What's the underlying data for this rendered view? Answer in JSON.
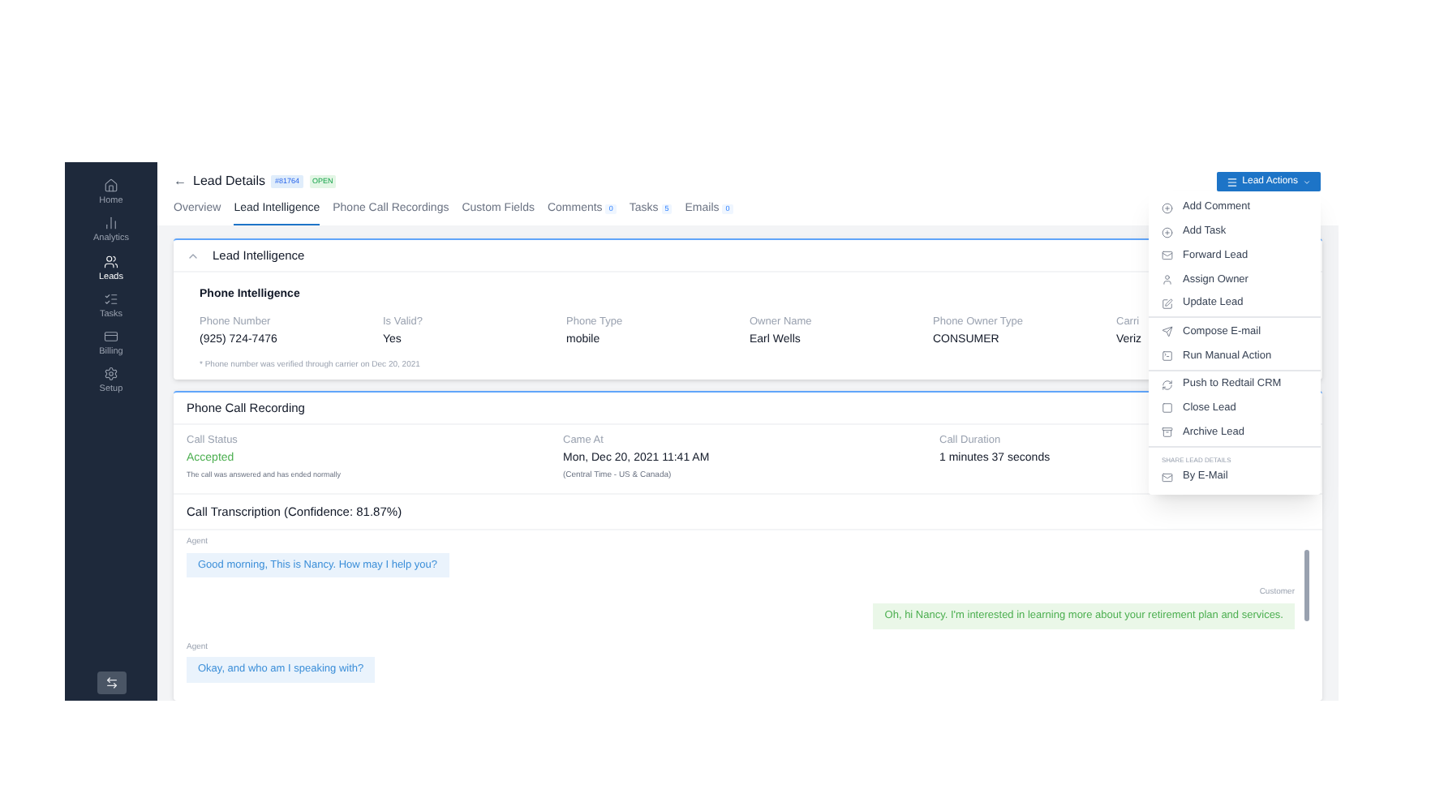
{
  "sidebar": {
    "items": [
      {
        "label": "Home",
        "selected": false
      },
      {
        "label": "Analytics",
        "selected": false
      },
      {
        "label": "Leads",
        "selected": true
      },
      {
        "label": "Tasks",
        "selected": false
      },
      {
        "label": "Billing",
        "selected": false
      },
      {
        "label": "Setup",
        "selected": false
      }
    ]
  },
  "header": {
    "back": "←",
    "title": "Lead Details",
    "badges": [
      {
        "text": "#81764",
        "kind": "id"
      },
      {
        "text": "OPEN",
        "kind": "status"
      }
    ],
    "actions_button": "Lead Actions"
  },
  "tabs": [
    {
      "label": "Overview",
      "selected": false
    },
    {
      "label": "Lead Intelligence",
      "selected": true
    },
    {
      "label": "Phone Call Recordings",
      "selected": false
    },
    {
      "label": "Custom Fields",
      "selected": false
    },
    {
      "label": "Comments",
      "count": "0",
      "selected": false
    },
    {
      "label": "Tasks",
      "count": "5",
      "selected": false
    },
    {
      "label": "Emails",
      "count": "0",
      "selected": false
    }
  ],
  "lead_intelligence": {
    "title": "Lead Intelligence",
    "expanded": true,
    "section": "Phone Intelligence",
    "fields": [
      {
        "label": "Phone Number",
        "value": "(925) 724-7476"
      },
      {
        "label": "Is Valid?",
        "value": "Yes"
      },
      {
        "label": "Phone Type",
        "value": "mobile"
      },
      {
        "label": "Owner Name",
        "value": "Earl Wells"
      },
      {
        "label": "Phone Owner Type",
        "value": "CONSUMER"
      },
      {
        "label": "Carri",
        "value": "Veriz"
      }
    ],
    "note": "* Phone number was verified through carrier on Dec 20, 2021"
  },
  "call_recording": {
    "title": "Phone Call Recording",
    "status_label": "Call Status",
    "status": "Accepted",
    "status_note": "The call was answered and has ended normally",
    "started_label": "Came At",
    "started": "Mon, Dec 20, 2021 11:41 AM",
    "timezone": "(Central Time - US & Canada)",
    "duration_label": "Call Duration",
    "duration": "1 minutes 37 seconds",
    "transcription_title": "Call Transcription (Confidence: 81.87%)",
    "messages": [
      {
        "speaker": "Agent",
        "kind": "agent",
        "text": "Good morning, This is Nancy. How may I help you?"
      },
      {
        "speaker": "Customer",
        "kind": "customer",
        "text": "Oh, hi Nancy. I'm interested in learning more about your retirement plan and services."
      },
      {
        "speaker": "Agent",
        "kind": "agent",
        "text": "Okay, and who am I speaking with?"
      }
    ]
  },
  "menu": {
    "groups": [
      {
        "items": [
          {
            "label": "Add Comment"
          },
          {
            "label": "Add Task"
          },
          {
            "label": "Forward Lead"
          },
          {
            "label": "Assign Owner"
          },
          {
            "label": "Update Lead"
          }
        ]
      },
      {
        "items": [
          {
            "label": "Compose E-mail"
          },
          {
            "label": "Run Manual Action"
          }
        ]
      },
      {
        "items": [
          {
            "label": "Push to Redtail CRM"
          },
          {
            "label": "Close Lead"
          },
          {
            "label": "Archive Lead"
          }
        ]
      },
      {
        "heading": "SHARE LEAD DETAILS",
        "items": [
          {
            "label": "By E-Mail"
          }
        ]
      }
    ]
  }
}
